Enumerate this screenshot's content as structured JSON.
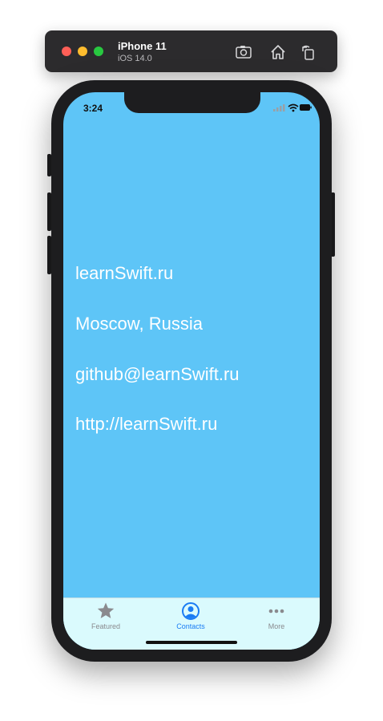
{
  "simulator": {
    "device_name": "iPhone 11",
    "os_version": "iOS 14.0",
    "icons": [
      "screenshot-icon",
      "home-icon",
      "rotate-icon"
    ]
  },
  "status_bar": {
    "time": "3:24",
    "icons": [
      "signal-icon",
      "wifi-icon",
      "battery-icon"
    ]
  },
  "content": {
    "background_color": "#5ec5f7",
    "lines": [
      "learnSwift.ru",
      "Moscow, Russia",
      "github@learnSwift.ru",
      "http://learnSwift.ru"
    ]
  },
  "tab_bar": {
    "items": [
      {
        "label": "Featured",
        "icon": "star-icon",
        "selected": false
      },
      {
        "label": "Contacts",
        "icon": "person-circle-icon",
        "selected": true
      },
      {
        "label": "More",
        "icon": "more-dots-icon",
        "selected": false
      }
    ],
    "accent_color": "#1a7cf4",
    "background_color": "#dafafd"
  }
}
